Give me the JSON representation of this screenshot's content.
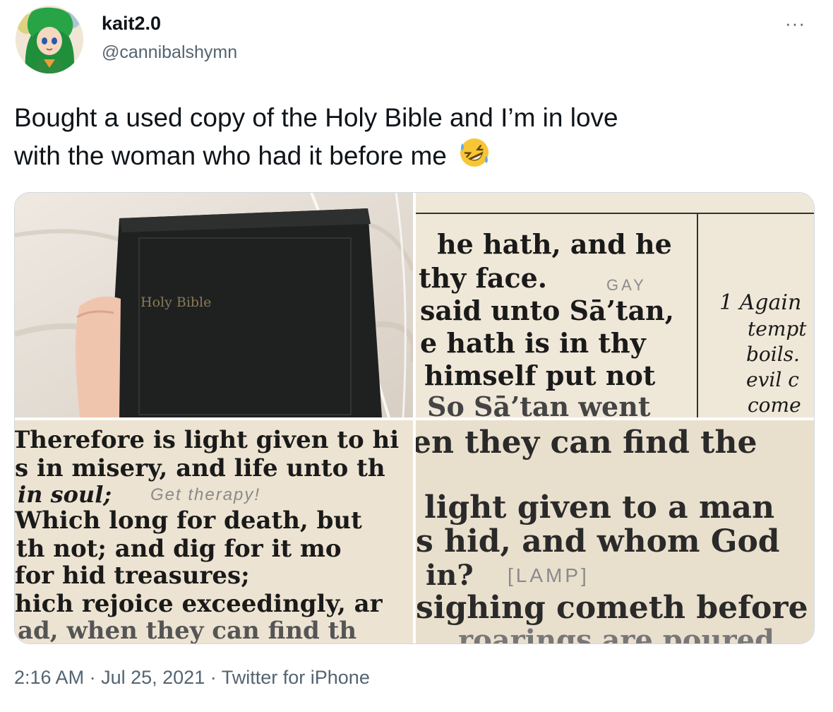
{
  "author": {
    "name": "kait2.0",
    "handle": "@cannibalshymn"
  },
  "menu": {
    "more_label": "···"
  },
  "tweet": {
    "text_line1": "Bought a used copy of the Holy Bible and I’m in love",
    "text_line2": "with the woman who had it before me",
    "emoji": "rolling-on-floor-laughing-emoji"
  },
  "media": {
    "photo1": {
      "book_label": "Holy Bible"
    },
    "photo2": {
      "lines": [
        "he hath, and he",
        "thy face.",
        "said unto Sā’tan,",
        "e hath is in thy",
        "himself put not",
        "So Sā’tan went"
      ],
      "side_lines": [
        "1 Again",
        "tempt",
        "boils.",
        "evil c",
        "come"
      ],
      "annotation": "GAY"
    },
    "photo3": {
      "lines": [
        "Therefore is light given to hi",
        "s in misery, and life unto th",
        "in soul;",
        "Which long for death, but",
        "th not; and dig for it mo",
        "for hid treasures;",
        "hich rejoice exceedingly, ar",
        "ad, when they can find th"
      ],
      "annotation": "Get therapy!"
    },
    "photo4": {
      "lines": [
        "en they can find the",
        "light given to a man",
        "s hid, and whom God",
        "in?",
        "sighing cometh before",
        "roarings are poured"
      ],
      "annotation": "[LAMP]"
    }
  },
  "meta": {
    "time": "2:16 AM",
    "sep1": "·",
    "date": "Jul 25, 2021",
    "sep2": "·",
    "source": "Twitter for iPhone"
  },
  "colors": {
    "text_primary": "#0f1419",
    "text_secondary": "#536471",
    "border": "#cfd9de",
    "paper": "#efe7d8",
    "book": "#1f2121"
  }
}
